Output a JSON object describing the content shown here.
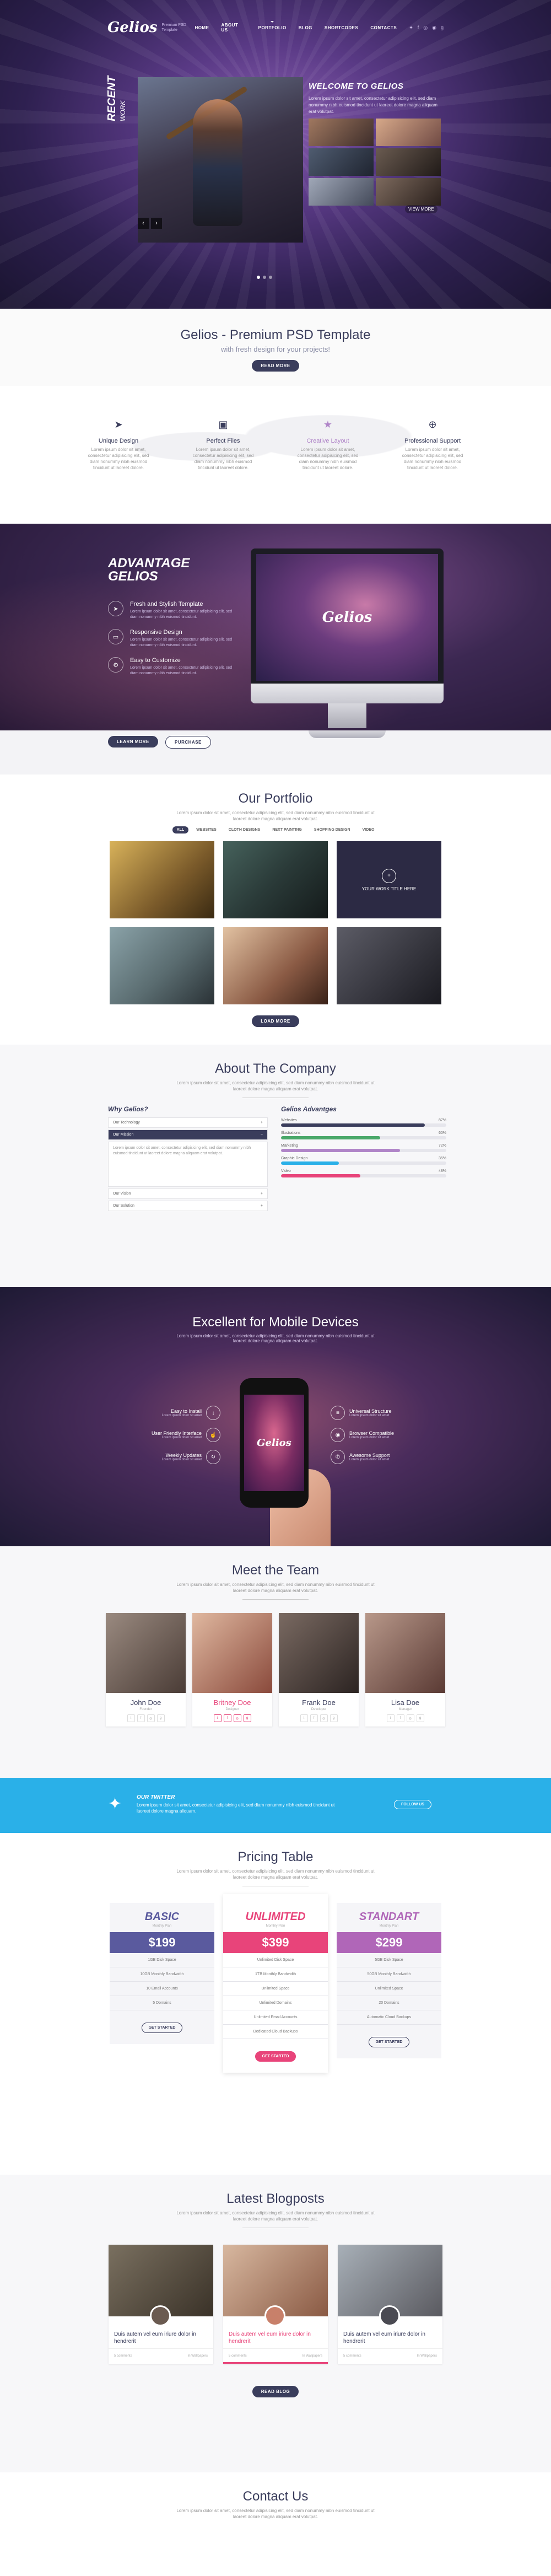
{
  "header": {
    "logo": "Gelios",
    "logo_tagline": "Premium PSD Template",
    "nav": [
      "HOME",
      "ABOUT US",
      "PORTFOLIO",
      "BLOG",
      "SHORTCODES",
      "CONTACTS"
    ],
    "social_icons": [
      "twitter-icon",
      "facebook-icon",
      "dribbble-icon",
      "rss-icon",
      "google-plus-icon"
    ]
  },
  "hero": {
    "side_title": "RECENT",
    "side_subtitle": "WORK",
    "welcome_title": "WELCOME TO GELIOS",
    "welcome_text": "Lorem ipsum dolor sit amet, consectetur adipisicing elit, sed diam nonummy nibh euismod tincidunt ut laoreet dolore magna aliquam erat volutpat.",
    "view_more": "VIEW MORE",
    "prev_arrow": "‹",
    "next_arrow": "›"
  },
  "intro": {
    "title": "Gelios - Premium PSD Template",
    "subtitle": "with fresh design for your projects!",
    "button": "READ MORE"
  },
  "features": [
    {
      "icon": "paper-plane-icon",
      "title": "Unique Design",
      "text": "Lorem ipsum dolor sit amet, consectetur adipisicing elit, sed diam nonummy nibh euismod tincidunt ut laoreet dolore."
    },
    {
      "icon": "shopping-bag-icon",
      "title": "Perfect Files",
      "text": "Lorem ipsum dolor sit amet, consectetur adipisicing elit, sed diam nonummy nibh euismod tincidunt ut laoreet dolore."
    },
    {
      "icon": "star-icon",
      "title": "Creative Layout",
      "text": "Lorem ipsum dolor sit amet, consectetur adipisicing elit, sed diam nonummy nibh euismod tincidunt ut laoreet dolore."
    },
    {
      "icon": "lifebuoy-icon",
      "title": "Professional Support",
      "text": "Lorem ipsum dolor sit amet, consectetur adipisicing elit, sed diam nonummy nibh euismod tincidunt ut laoreet dolore."
    }
  ],
  "advantage": {
    "title_line1": "ADVANTAGE",
    "title_line2": "GELIOS",
    "items": [
      {
        "title": "Fresh and Stylish Template",
        "text": "Lorem ipsum dolor sit amet, consectetur adipisicing elit, sed diam nonummy nibh euismod tincidunt."
      },
      {
        "title": "Responsive Design",
        "text": "Lorem ipsum dolor sit amet, consectetur adipisicing elit, sed diam nonummy nibh euismod tincidunt."
      },
      {
        "title": "Easy to Customize",
        "text": "Lorem ipsum dolor sit amet, consectetur adipisicing elit, sed diam nonummy nibh euismod tincidunt."
      }
    ],
    "screen_logo": "Gelios",
    "btn_learn": "LEARN MORE",
    "btn_purchase": "PURCHASE"
  },
  "portfolio": {
    "title": "Our Portfolio",
    "subtitle": "Lorem ipsum dolor sit amet, consectetur adipisicing elit, sed diam nonummy nibh euismod tincidunt ut laoreet dolore magna aliquam erat volutpat.",
    "filters": [
      "ALL",
      "WEBSITES",
      "CLOTH DESIGNS",
      "NEXT PAINTING",
      "SHOPPING DESIGN",
      "VIDEO"
    ],
    "hover_text": "YOUR WORK TITLE HERE",
    "button": "LOAD MORE"
  },
  "about": {
    "title": "About The Company",
    "subtitle": "Lorem ipsum dolor sit amet, consectetur adipisicing elit, sed diam nonummy nibh euismod tincidunt ut laoreet dolore magna aliquam erat volutpat.",
    "why_title": "Why Gelios?",
    "accordion": [
      "Our Technology",
      "Our Mission",
      "Our Vision",
      "Our Solution"
    ],
    "accordion_body": "Lorem ipsum dolor sit amet, consectetur adipisicing elit, sed diam nonummy nibh euismod tincidunt ut laoreet dolore magna aliquam erat volutpat.",
    "skills_title": "Gelios Advantges",
    "skills": [
      {
        "label": "Websites",
        "value": 87,
        "color": "#3a3d5c"
      },
      {
        "label": "Illustrations",
        "value": 60,
        "color": "#4aa86a"
      },
      {
        "label": "Marketing",
        "value": 72,
        "color": "#b085c8"
      },
      {
        "label": "Graphic Design",
        "value": 35,
        "color": "#2ab0e8"
      },
      {
        "label": "Video",
        "value": 48,
        "color": "#e8447a"
      }
    ]
  },
  "mobile": {
    "title": "Excellent for Mobile Devices",
    "subtitle": "Lorem ipsum dolor sit amet, consectetur adipisicing elit, sed diam nonummy nibh euismod tincidunt ut laoreet dolore magna aliquam erat volutpat.",
    "phone_logo": "Gelios",
    "left": [
      {
        "title": "Easy to Install",
        "text": "Lorem ipsum dolor sit amet"
      },
      {
        "title": "User Friendly Interface",
        "text": "Lorem ipsum dolor sit amet"
      },
      {
        "title": "Weekly Updates",
        "text": "Lorem ipsum dolor sit amet"
      }
    ],
    "right": [
      {
        "title": "Universal Structure",
        "text": "Lorem ipsum dolor sit amet"
      },
      {
        "title": "Browser Compatible",
        "text": "Lorem ipsum dolor sit amet"
      },
      {
        "title": "Awesome Support",
        "text": "Lorem ipsum dolor sit amet"
      }
    ]
  },
  "team": {
    "title": "Meet the Team",
    "subtitle": "Lorem ipsum dolor sit amet, consectetur adipisicing elit, sed diam nonummy nibh euismod tincidunt ut laoreet dolore magna aliquam erat volutpat.",
    "members": [
      {
        "name": "John Doe",
        "role": "Founder"
      },
      {
        "name": "Britney Doe",
        "role": "Designer"
      },
      {
        "name": "Frank Doe",
        "role": "Developer"
      },
      {
        "name": "Lisa Doe",
        "role": "Manager"
      }
    ]
  },
  "twitter": {
    "title": "OUR TWITTER",
    "text": "Lorem ipsum dolor sit amet, consectetur adipisicing elit, sed diam nonummy nibh euismod tincidunt ut laoreet dolore magna aliquam.",
    "button": "FOLLOW US"
  },
  "pricing": {
    "title": "Pricing Table",
    "subtitle": "Lorem ipsum dolor sit amet, consectetur adipisicing elit, sed diam nonummy nibh euismod tincidunt ut laoreet dolore magna aliquam erat volutpat.",
    "plans": [
      {
        "name": "BASIC",
        "period": "Monthly Plan",
        "price": "$199",
        "color": "#5a5a9e",
        "rows": [
          "1GB Disk Space",
          "10GB Monthly Bandwidth",
          "10 Email Accounts",
          "5 Domains"
        ],
        "button": "GET STARTED"
      },
      {
        "name": "UNLIMITED",
        "period": "Monthly Plan",
        "price": "$399",
        "color": "#e8447a",
        "rows": [
          "Unlimited Disk Space",
          "1TB Monthly Bandwidth",
          "Unlimited Space",
          "Unlimited Domains",
          "Unlimited Email Accounts",
          "Dedicated Cloud Backups"
        ],
        "button": "GET STARTED"
      },
      {
        "name": "STANDART",
        "period": "Monthly Plan",
        "price": "$299",
        "color": "#b066b8",
        "rows": [
          "5GB Disk Space",
          "50GB Monthly Bandwidth",
          "Unlimited Space",
          "20 Domains",
          "Automatic Cloud Backups"
        ],
        "button": "GET STARTED"
      }
    ]
  },
  "blog": {
    "title": "Latest Blogposts",
    "subtitle": "Lorem ipsum dolor sit amet, consectetur adipisicing elit, sed diam nonummy nibh euismod tincidunt ut laoreet dolore magna aliquam erat volutpat.",
    "posts": [
      {
        "title": "Duis autem vel eum iriure dolor in hendrerit",
        "comments": "5 comments",
        "category": "In Wallpapers"
      },
      {
        "title": "Duis autem vel eum iriure dolor in hendrerit",
        "comments": "5 comments",
        "category": "In Wallpapers"
      },
      {
        "title": "Duis autem vel eum iriure dolor in hendrerit",
        "comments": "5 comments",
        "category": "In Wallpapers"
      }
    ],
    "button": "READ BLOG"
  },
  "contact": {
    "title": "Contact Us",
    "subtitle": "Lorem ipsum dolor sit amet, consectetur adipisicing elit, sed diam nonummy nibh euismod tincidunt ut laoreet dolore magna aliquam erat volutpat."
  }
}
